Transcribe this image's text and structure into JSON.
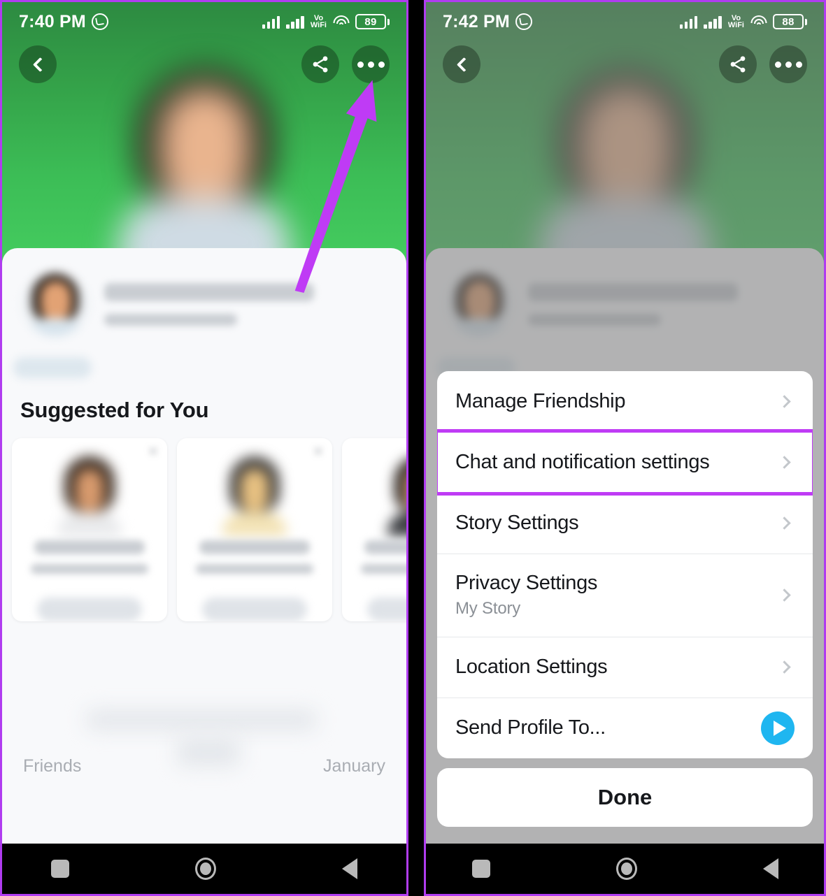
{
  "left_phone": {
    "status_bar": {
      "time": "7:40 PM",
      "whatsapp_icon": "whatsapp-icon",
      "signal1_icon": "signal-bars-icon",
      "signal2_icon": "signal-bars-icon",
      "volte_top": "Vo",
      "volte_bottom": "WiFi",
      "wifi_icon": "wifi-icon",
      "battery": "89"
    },
    "top_nav": {
      "back_icon": "chevron-left-icon",
      "share_icon": "share-icon",
      "more_icon": "more-options-icon"
    },
    "profile": {
      "avatar": "profile-avatar",
      "name_redacted": "",
      "subtitle_redacted": "",
      "chip_redacted": ""
    },
    "suggested": {
      "title": "Suggested for You",
      "cards": [
        {
          "name_redacted": "",
          "sub_redacted": "",
          "button_redacted": ""
        },
        {
          "name_redacted": "",
          "sub_redacted": "",
          "button_redacted": ""
        },
        {
          "name_redacted": "",
          "sub_redacted": "",
          "button_redacted": ""
        }
      ]
    },
    "footer": {
      "left_label": "Friends",
      "right_label": "January"
    },
    "annotation": {
      "arrow_color": "#bf3bf5",
      "points_to": "more-options-icon"
    }
  },
  "right_phone": {
    "status_bar": {
      "time": "7:42 PM",
      "whatsapp_icon": "whatsapp-icon",
      "signal1_icon": "signal-bars-icon",
      "signal2_icon": "signal-bars-icon",
      "volte_top": "Vo",
      "volte_bottom": "WiFi",
      "wifi_icon": "wifi-icon",
      "battery": "88"
    },
    "top_nav": {
      "back_icon": "chevron-left-icon",
      "share_icon": "share-icon",
      "more_icon": "more-options-icon"
    },
    "action_sheet": {
      "items": [
        {
          "label": "Manage Friendship",
          "sub": "",
          "accessory": "chevron-right-icon",
          "highlighted": false
        },
        {
          "label": "Chat and notification settings",
          "sub": "",
          "accessory": "chevron-right-icon",
          "highlighted": true
        },
        {
          "label": "Story Settings",
          "sub": "",
          "accessory": "chevron-right-icon",
          "highlighted": false
        },
        {
          "label": "Privacy Settings",
          "sub": "My Story",
          "accessory": "chevron-right-icon",
          "highlighted": false
        },
        {
          "label": "Location Settings",
          "sub": "",
          "accessory": "chevron-right-icon",
          "highlighted": false
        },
        {
          "label": "Send Profile To...",
          "sub": "",
          "accessory": "send-icon",
          "highlighted": false
        }
      ],
      "done_label": "Done"
    },
    "highlight_color": "#bf3bf5"
  },
  "nav_bar": {
    "recents_icon": "square-recents-icon",
    "home_icon": "circle-home-icon",
    "back_icon": "triangle-back-icon"
  },
  "colors": {
    "accent_purple": "#bf3bf5",
    "header_green_top": "#2d8a41",
    "header_green_bottom": "#46cf61",
    "send_blue": "#1fb6f0",
    "frame_border": "#b03cf0"
  }
}
